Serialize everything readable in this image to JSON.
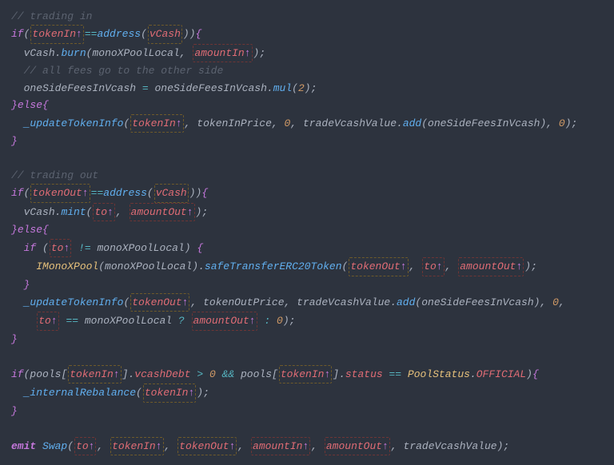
{
  "c1": "// trading in",
  "c2": "// all fees go to the other side",
  "c3": "// trading out",
  "if": "if",
  "else": "else",
  "emit": "emit",
  "tokenIn": "tokenIn",
  "tokenOut": "tokenOut",
  "amountIn": "amountIn",
  "amountOut": "amountOut",
  "to": "to",
  "address": "address",
  "vCash": "vCash",
  "burn": "burn",
  "mint": "mint",
  "mul": "mul",
  "add": "add",
  "mono": "monoXPoolLocal",
  "one": "oneSideFeesInVcash",
  "uti": "_updateTokenInfo",
  "tokenInPrice": "tokenInPrice",
  "tokenOutPrice": "tokenOutPrice",
  "trade": "tradeVcashValue",
  "impool": "IMonoXPool",
  "safe": "safeTransferERC20Token",
  "pools": "pools",
  "vcashDebt": "vcashDebt",
  "status": "status",
  "poolStatus": "PoolStatus",
  "official": "OFFICIAL",
  "irb": "_internalRebalance",
  "swap": "Swap",
  "zero": "0",
  "two": "2",
  "eqeq": "==",
  "neq": "!=",
  "and": "&&",
  "assign": "=",
  "gt": ">",
  "q": "?",
  "col": ":",
  "dot": ".",
  "comma": ",",
  "semi": ";",
  "op": "(",
  "cp": ")",
  "ob": "{",
  "cb": "}",
  "obk": "[",
  "cbk": "]",
  "arrow": "↑"
}
